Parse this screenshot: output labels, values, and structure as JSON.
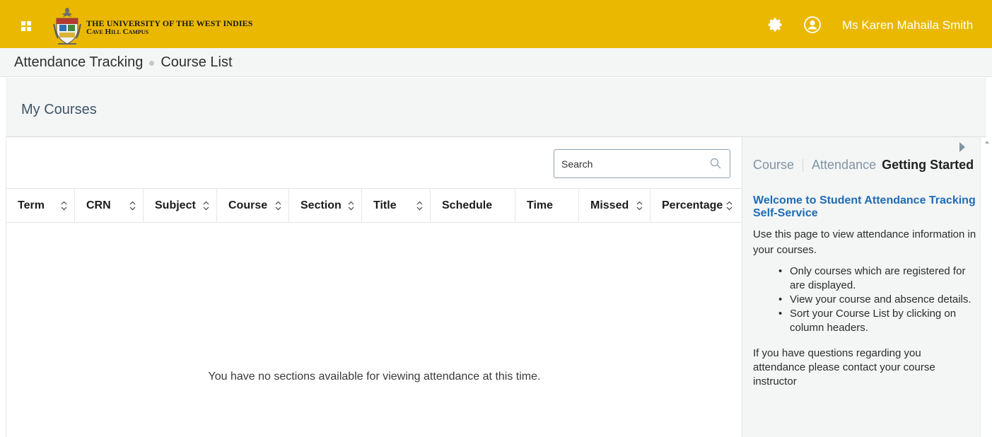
{
  "header": {
    "university_line1": "THE UNIVERSITY OF THE WEST INDIES",
    "university_line2": "Cave Hill Campus",
    "user_name": "Ms Karen Mahaila Smith",
    "background_color": "#eab800"
  },
  "breadcrumb": {
    "items": [
      "Attendance Tracking",
      "Course List"
    ]
  },
  "page": {
    "title": "My Courses"
  },
  "search": {
    "placeholder": "Search"
  },
  "table": {
    "columns": [
      {
        "label": "Term",
        "sortable": true
      },
      {
        "label": "CRN",
        "sortable": true
      },
      {
        "label": "Subject",
        "sortable": true
      },
      {
        "label": "Course",
        "sortable": true
      },
      {
        "label": "Section",
        "sortable": true
      },
      {
        "label": "Title",
        "sortable": true
      },
      {
        "label": "Schedule",
        "sortable": false
      },
      {
        "label": "Time",
        "sortable": false
      },
      {
        "label": "Missed",
        "sortable": true
      },
      {
        "label": "Percentage",
        "sortable": true
      }
    ],
    "empty_message": "You have no sections available for viewing attendance at this time."
  },
  "sidebar": {
    "tabs": [
      "Course",
      "Attendance",
      "Getting Started"
    ],
    "active_tab": "Getting Started",
    "welcome_title": "Welcome to Student Attendance Tracking Self-Service",
    "intro": "Use this page to view attendance information in your courses.",
    "bullets": [
      "Only courses which are registered for are displayed.",
      "View your course and absence details.",
      "Sort your Course List by clicking on column headers."
    ],
    "contact": "If you have questions regarding you attendance please contact your course instructor"
  },
  "colors": {
    "accent_blue": "#1e6cb6",
    "title_slate": "#3e5568",
    "inactive_tab": "#8194a4"
  }
}
